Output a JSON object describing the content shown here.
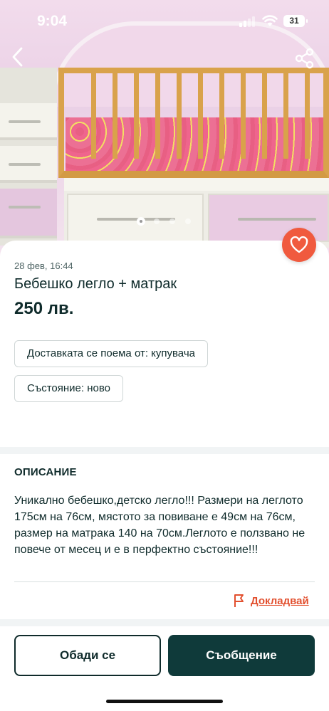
{
  "status_bar": {
    "time": "9:04",
    "battery": "31"
  },
  "header": {
    "back_icon": "chevron-left-icon",
    "share_icon": "share-icon"
  },
  "gallery": {
    "image_count": 4,
    "active_index": 0
  },
  "listing": {
    "date": "28 фев, 16:44",
    "title": "Бебешко легло + матрак",
    "price": "250 лв.",
    "favorite_icon": "heart-icon",
    "chips": [
      "Доставката се поема от: купувача",
      "Състояние: ново"
    ]
  },
  "description": {
    "heading": "ОПИСАНИЕ",
    "text": "Уникално бебешко,детско легло!!! Размери на леглото 175см на 76см, мястото за повиване е 49см на 76см, размер на матрака 140 на 70см.Леглото е ползвано не повече от месец и е в перфектно състояние!!!"
  },
  "report": {
    "label": "Докладвай",
    "icon": "flag-icon"
  },
  "actions": {
    "call": "Обади се",
    "message": "Съобщение"
  },
  "colors": {
    "accent": "#f05a3e",
    "primary_dark": "#0f3a3a",
    "text": "#0f2b2b"
  }
}
